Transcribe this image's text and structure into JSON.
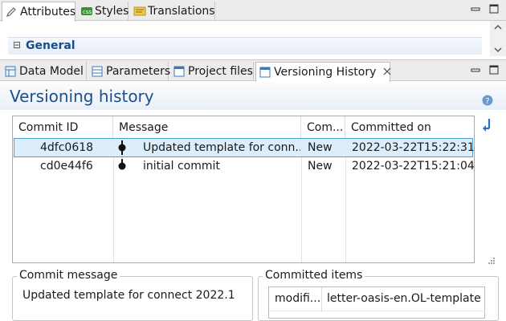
{
  "top_tabs": [
    {
      "label": "Attributes",
      "icon": "pencil-icon"
    },
    {
      "label": "Styles",
      "icon": "css-icon"
    },
    {
      "label": "Translations",
      "icon": "translations-icon"
    }
  ],
  "general_section": {
    "expander": "⊟",
    "label": "General"
  },
  "main_tabs": [
    {
      "label": "Data Model",
      "icon": "data-model-icon"
    },
    {
      "label": "Parameters",
      "icon": "parameters-icon"
    },
    {
      "label": "Project files",
      "icon": "project-files-icon"
    },
    {
      "label": "Versioning History",
      "icon": "versioning-icon",
      "active": true
    }
  ],
  "versioning": {
    "title": "Versioning history",
    "columns": [
      "Commit ID",
      "Message",
      "Com...",
      "Committed on"
    ],
    "rows": [
      {
        "id": "4dfc0618",
        "message": "Updated template for conn...",
        "status": "New",
        "date": "2022-03-22T15:22:31",
        "selected": true
      },
      {
        "id": "cd0e44f6",
        "message": "initial commit",
        "status": "New",
        "date": "2022-03-22T15:21:04",
        "selected": false
      }
    ]
  },
  "commit_message": {
    "label": "Commit message",
    "text": "Updated template for connect 2022.1"
  },
  "committed_items": {
    "label": "Committed items",
    "status": "modifi...",
    "file": "letter-oasis-en.OL-template"
  },
  "colors": {
    "accent": "#1f4f86",
    "selection": "#dceefb",
    "selection_border": "#4fa0d9"
  }
}
